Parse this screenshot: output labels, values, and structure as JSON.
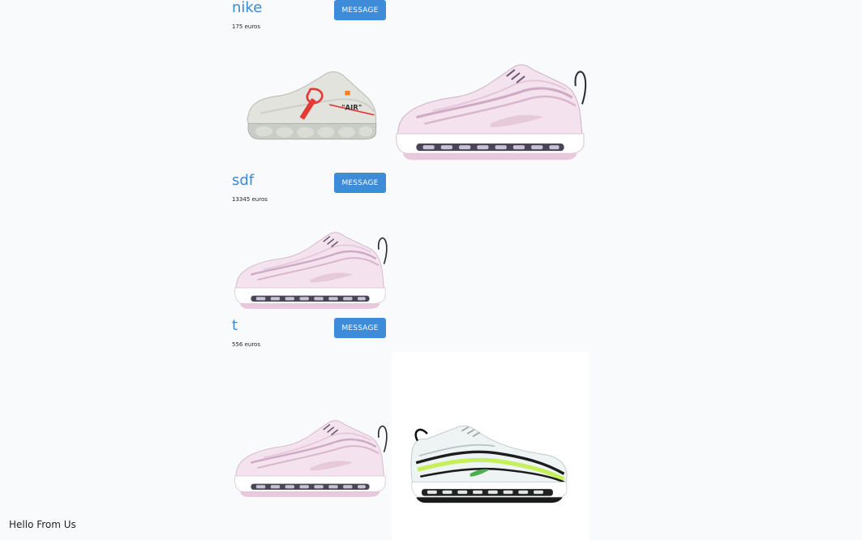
{
  "listings": [
    {
      "title": "nike",
      "price": "175 euros",
      "button_label": "MESSAGE"
    },
    {
      "title": "sdf",
      "price": "13345 euros",
      "button_label": "MESSAGE"
    },
    {
      "title": "t",
      "price": "556 euros",
      "button_label": "MESSAGE"
    }
  ],
  "images": [
    {
      "name": "white-vapormax-sneaker",
      "accent": "#e53935"
    },
    {
      "name": "pink-air-max-97"
    },
    {
      "name": "pink-air-max-97"
    },
    {
      "name": "pink-air-max-97"
    },
    {
      "name": "white-volt-air-max-97",
      "accent": "#c6f05a"
    }
  ],
  "footer": {
    "text": "Hello From Us"
  }
}
